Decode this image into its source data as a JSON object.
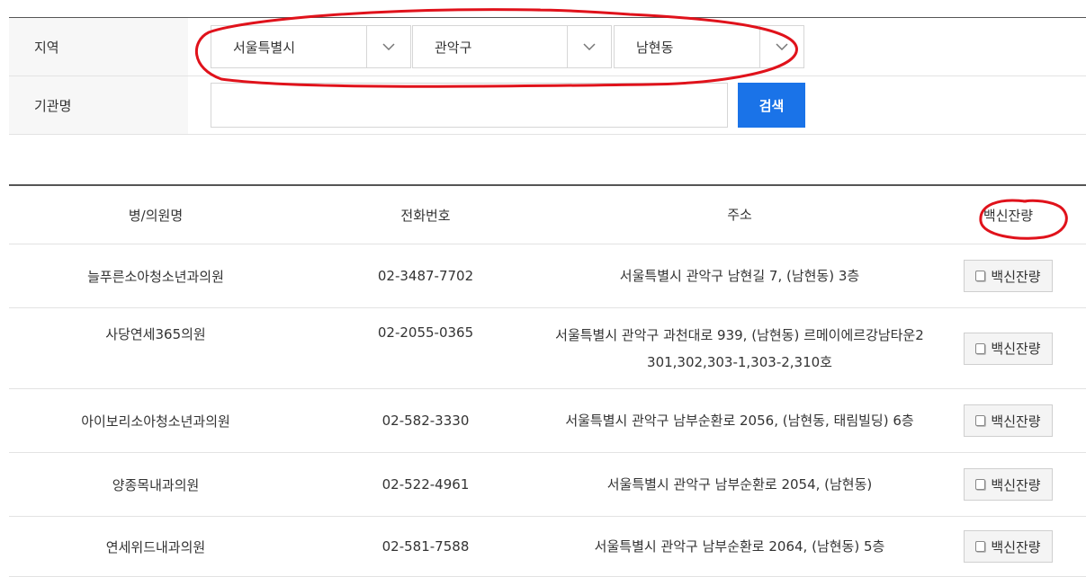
{
  "search": {
    "region_label": "지역",
    "city": "서울특별시",
    "district": "관악구",
    "dong": "남현동",
    "name_label": "기관명",
    "name_value": "",
    "search_label": "검색"
  },
  "table": {
    "headers": [
      "병/의원명",
      "전화번호",
      "주소",
      "백신잔량"
    ],
    "rows": [
      {
        "name": "늘푸른소아청소년과의원",
        "phone": "02-3487-7702",
        "address": [
          "서울특별시 관악구 남현길 7, (남현동) 3층"
        ],
        "button": "백신잔량"
      },
      {
        "name": "사당연세365의원",
        "phone": "02-2055-0365",
        "address": [
          "서울특별시 관악구 과천대로 939, (남현동) 르메이에르강남타운2",
          "301,302,303-1,303-2,310호"
        ],
        "button": "백신잔량"
      },
      {
        "name": "아이보리소아청소년과의원",
        "phone": "02-582-3330",
        "address": [
          "서울특별시 관악구 남부순환로 2056, (남현동, 태림빌딩) 6층"
        ],
        "button": "백신잔량"
      },
      {
        "name": "양종목내과의원",
        "phone": "02-522-4961",
        "address": [
          "서울특별시 관악구 남부순환로 2054, (남현동)"
        ],
        "button": "백신잔량"
      },
      {
        "name": "연세위드내과의원",
        "phone": "02-581-7588",
        "address": [
          "서울특별시 관악구 남부순환로 2064, (남현동) 5층"
        ],
        "button": "백신잔량"
      }
    ]
  },
  "colors": {
    "accent": "#1a73e8",
    "annotation": "#e0121b"
  }
}
